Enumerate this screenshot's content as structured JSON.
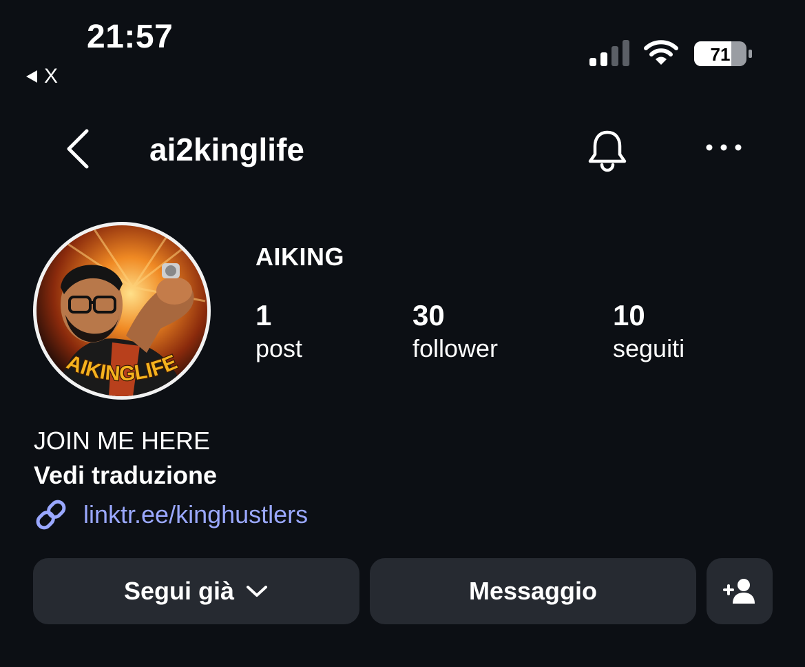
{
  "status_bar": {
    "time": "21:57",
    "back_app": "X",
    "battery": "71"
  },
  "header": {
    "username": "ai2kinglife",
    "icons": [
      "back-chevron-icon",
      "bell-icon",
      "more-dots-icon"
    ]
  },
  "profile": {
    "avatar_text": "AIKINGLIFE",
    "display_name": "AIKING",
    "stats": [
      {
        "value": "1",
        "label": "post"
      },
      {
        "value": "30",
        "label": "follower"
      },
      {
        "value": "10",
        "label": "seguiti"
      }
    ],
    "bio": "JOIN ME HERE",
    "see_translation": "Vedi traduzione",
    "link": "linktr.ee/kinghustlers"
  },
  "actions": {
    "follow_label": "Segui già",
    "message_label": "Messaggio",
    "add_user_icon": "add-user-icon"
  },
  "colors": {
    "background": "#0c0f14",
    "button": "#262a31",
    "link": "#9aa8ff"
  }
}
